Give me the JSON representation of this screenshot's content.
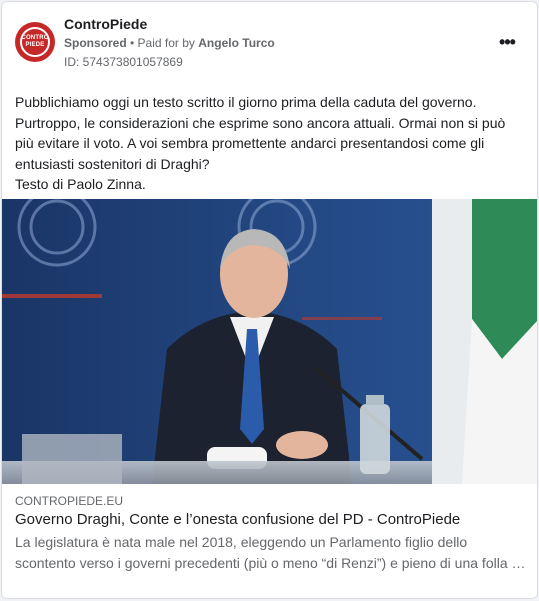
{
  "post": {
    "page_name": "ControPiede",
    "avatar_logo_text": [
      "CONTRO",
      "PIEDE"
    ],
    "sponsored_label": "Sponsored",
    "paid_for_prefix": "• Paid for by",
    "payer_name": "Angelo Turco",
    "ad_id": "ID: 574373801057869",
    "more_icon": "more-horizontal-icon",
    "more_glyph": "•••",
    "body_text": "Pubblichiamo oggi un testo scritto il giorno prima della caduta del governo.\nPurtroppo, le considerazioni che esprime sono ancora attuali. Ormai non si può più evitare il voto. A voi sembra promettente andarci presentandosi come gli entusiasti sostenitori di Draghi?\nTesto di Paolo Zinna."
  },
  "link_preview": {
    "domain": "CONTROPIEDE.EU",
    "title": "Governo Draghi, Conte e l’onesta confusione del PD - ControPiede",
    "description": "La legislatura è nata male nel 2018, eleggendo un Parlamento figlio dello scontento verso i governi precedenti (più o meno “di Renzi”) e pieno di una folla …"
  },
  "colors": {
    "brand_red": "#c62828",
    "text_primary": "#1c1e21",
    "text_secondary": "#65676b",
    "backdrop_blue": "#1d3a6e"
  }
}
